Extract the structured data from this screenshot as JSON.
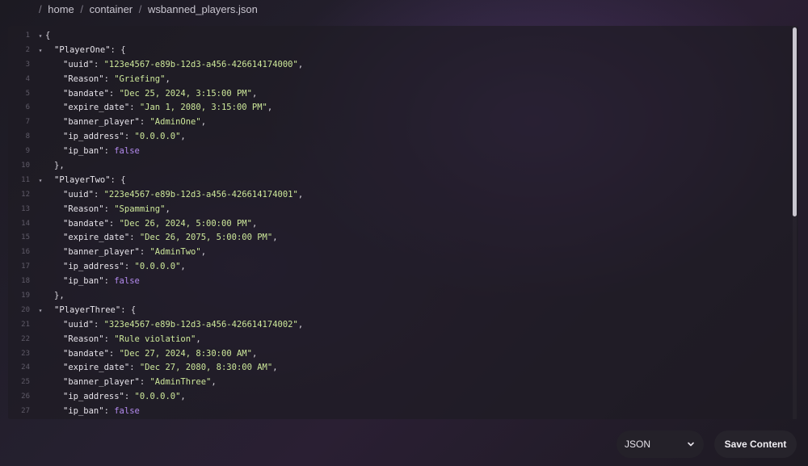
{
  "breadcrumb": {
    "items": [
      "home",
      "container",
      "wsbanned_players.json"
    ]
  },
  "colors": {
    "key": "#e6e3ea",
    "string": "#cde89a",
    "boolean": "#b58cf0",
    "line_number": "#5f5b68"
  },
  "editor": {
    "lines": [
      {
        "n": "1",
        "fold": true,
        "indent": 0,
        "parts": [
          {
            "t": "{",
            "c": "punct"
          }
        ]
      },
      {
        "n": "2",
        "fold": true,
        "indent": 1,
        "parts": [
          {
            "t": "\"PlayerOne\"",
            "c": "key"
          },
          {
            "t": ": {",
            "c": "punct"
          }
        ]
      },
      {
        "n": "3",
        "fold": false,
        "indent": 2,
        "parts": [
          {
            "t": "\"uuid\"",
            "c": "key"
          },
          {
            "t": ": ",
            "c": "punct"
          },
          {
            "t": "\"123e4567-e89b-12d3-a456-426614174000\"",
            "c": "str"
          },
          {
            "t": ",",
            "c": "punct"
          }
        ]
      },
      {
        "n": "4",
        "fold": false,
        "indent": 2,
        "parts": [
          {
            "t": "\"Reason\"",
            "c": "key"
          },
          {
            "t": ": ",
            "c": "punct"
          },
          {
            "t": "\"Griefing\"",
            "c": "str"
          },
          {
            "t": ",",
            "c": "punct"
          }
        ]
      },
      {
        "n": "5",
        "fold": false,
        "indent": 2,
        "parts": [
          {
            "t": "\"bandate\"",
            "c": "key"
          },
          {
            "t": ": ",
            "c": "punct"
          },
          {
            "t": "\"Dec 25, 2024, 3:15:00 PM\"",
            "c": "str"
          },
          {
            "t": ",",
            "c": "punct"
          }
        ]
      },
      {
        "n": "6",
        "fold": false,
        "indent": 2,
        "parts": [
          {
            "t": "\"expire_date\"",
            "c": "key"
          },
          {
            "t": ": ",
            "c": "punct"
          },
          {
            "t": "\"Jan 1, 2080, 3:15:00 PM\"",
            "c": "str"
          },
          {
            "t": ",",
            "c": "punct"
          }
        ]
      },
      {
        "n": "7",
        "fold": false,
        "indent": 2,
        "parts": [
          {
            "t": "\"banner_player\"",
            "c": "key"
          },
          {
            "t": ": ",
            "c": "punct"
          },
          {
            "t": "\"AdminOne\"",
            "c": "str"
          },
          {
            "t": ",",
            "c": "punct"
          }
        ]
      },
      {
        "n": "8",
        "fold": false,
        "indent": 2,
        "parts": [
          {
            "t": "\"ip_address\"",
            "c": "key"
          },
          {
            "t": ": ",
            "c": "punct"
          },
          {
            "t": "\"0.0.0.0\"",
            "c": "str"
          },
          {
            "t": ",",
            "c": "punct"
          }
        ]
      },
      {
        "n": "9",
        "fold": false,
        "indent": 2,
        "parts": [
          {
            "t": "\"ip_ban\"",
            "c": "key"
          },
          {
            "t": ": ",
            "c": "punct"
          },
          {
            "t": "false",
            "c": "bool"
          }
        ]
      },
      {
        "n": "10",
        "fold": false,
        "indent": 1,
        "parts": [
          {
            "t": "},",
            "c": "punct"
          }
        ]
      },
      {
        "n": "11",
        "fold": true,
        "indent": 1,
        "parts": [
          {
            "t": "\"PlayerTwo\"",
            "c": "key"
          },
          {
            "t": ": {",
            "c": "punct"
          }
        ]
      },
      {
        "n": "12",
        "fold": false,
        "indent": 2,
        "parts": [
          {
            "t": "\"uuid\"",
            "c": "key"
          },
          {
            "t": ": ",
            "c": "punct"
          },
          {
            "t": "\"223e4567-e89b-12d3-a456-426614174001\"",
            "c": "str"
          },
          {
            "t": ",",
            "c": "punct"
          }
        ]
      },
      {
        "n": "13",
        "fold": false,
        "indent": 2,
        "parts": [
          {
            "t": "\"Reason\"",
            "c": "key"
          },
          {
            "t": ": ",
            "c": "punct"
          },
          {
            "t": "\"Spamming\"",
            "c": "str"
          },
          {
            "t": ",",
            "c": "punct"
          }
        ]
      },
      {
        "n": "14",
        "fold": false,
        "indent": 2,
        "parts": [
          {
            "t": "\"bandate\"",
            "c": "key"
          },
          {
            "t": ": ",
            "c": "punct"
          },
          {
            "t": "\"Dec 26, 2024, 5:00:00 PM\"",
            "c": "str"
          },
          {
            "t": ",",
            "c": "punct"
          }
        ]
      },
      {
        "n": "15",
        "fold": false,
        "indent": 2,
        "parts": [
          {
            "t": "\"expire_date\"",
            "c": "key"
          },
          {
            "t": ": ",
            "c": "punct"
          },
          {
            "t": "\"Dec 26, 2075, 5:00:00 PM\"",
            "c": "str"
          },
          {
            "t": ",",
            "c": "punct"
          }
        ]
      },
      {
        "n": "16",
        "fold": false,
        "indent": 2,
        "parts": [
          {
            "t": "\"banner_player\"",
            "c": "key"
          },
          {
            "t": ": ",
            "c": "punct"
          },
          {
            "t": "\"AdminTwo\"",
            "c": "str"
          },
          {
            "t": ",",
            "c": "punct"
          }
        ]
      },
      {
        "n": "17",
        "fold": false,
        "indent": 2,
        "parts": [
          {
            "t": "\"ip_address\"",
            "c": "key"
          },
          {
            "t": ": ",
            "c": "punct"
          },
          {
            "t": "\"0.0.0.0\"",
            "c": "str"
          },
          {
            "t": ",",
            "c": "punct"
          }
        ]
      },
      {
        "n": "18",
        "fold": false,
        "indent": 2,
        "parts": [
          {
            "t": "\"ip_ban\"",
            "c": "key"
          },
          {
            "t": ": ",
            "c": "punct"
          },
          {
            "t": "false",
            "c": "bool"
          }
        ]
      },
      {
        "n": "19",
        "fold": false,
        "indent": 1,
        "parts": [
          {
            "t": "},",
            "c": "punct"
          }
        ]
      },
      {
        "n": "20",
        "fold": true,
        "indent": 1,
        "parts": [
          {
            "t": "\"PlayerThree\"",
            "c": "key"
          },
          {
            "t": ": {",
            "c": "punct"
          }
        ]
      },
      {
        "n": "21",
        "fold": false,
        "indent": 2,
        "parts": [
          {
            "t": "\"uuid\"",
            "c": "key"
          },
          {
            "t": ": ",
            "c": "punct"
          },
          {
            "t": "\"323e4567-e89b-12d3-a456-426614174002\"",
            "c": "str"
          },
          {
            "t": ",",
            "c": "punct"
          }
        ]
      },
      {
        "n": "22",
        "fold": false,
        "indent": 2,
        "parts": [
          {
            "t": "\"Reason\"",
            "c": "key"
          },
          {
            "t": ": ",
            "c": "punct"
          },
          {
            "t": "\"Rule violation\"",
            "c": "str"
          },
          {
            "t": ",",
            "c": "punct"
          }
        ]
      },
      {
        "n": "23",
        "fold": false,
        "indent": 2,
        "parts": [
          {
            "t": "\"bandate\"",
            "c": "key"
          },
          {
            "t": ": ",
            "c": "punct"
          },
          {
            "t": "\"Dec 27, 2024, 8:30:00 AM\"",
            "c": "str"
          },
          {
            "t": ",",
            "c": "punct"
          }
        ]
      },
      {
        "n": "24",
        "fold": false,
        "indent": 2,
        "parts": [
          {
            "t": "\"expire_date\"",
            "c": "key"
          },
          {
            "t": ": ",
            "c": "punct"
          },
          {
            "t": "\"Dec 27, 2080, 8:30:00 AM\"",
            "c": "str"
          },
          {
            "t": ",",
            "c": "punct"
          }
        ]
      },
      {
        "n": "25",
        "fold": false,
        "indent": 2,
        "parts": [
          {
            "t": "\"banner_player\"",
            "c": "key"
          },
          {
            "t": ": ",
            "c": "punct"
          },
          {
            "t": "\"AdminThree\"",
            "c": "str"
          },
          {
            "t": ",",
            "c": "punct"
          }
        ]
      },
      {
        "n": "26",
        "fold": false,
        "indent": 2,
        "parts": [
          {
            "t": "\"ip_address\"",
            "c": "key"
          },
          {
            "t": ": ",
            "c": "punct"
          },
          {
            "t": "\"0.0.0.0\"",
            "c": "str"
          },
          {
            "t": ",",
            "c": "punct"
          }
        ]
      },
      {
        "n": "27",
        "fold": false,
        "indent": 2,
        "parts": [
          {
            "t": "\"ip_ban\"",
            "c": "key"
          },
          {
            "t": ": ",
            "c": "punct"
          },
          {
            "t": "false",
            "c": "bool"
          }
        ]
      }
    ]
  },
  "footer": {
    "language_selected": "JSON",
    "save_label": "Save Content"
  }
}
